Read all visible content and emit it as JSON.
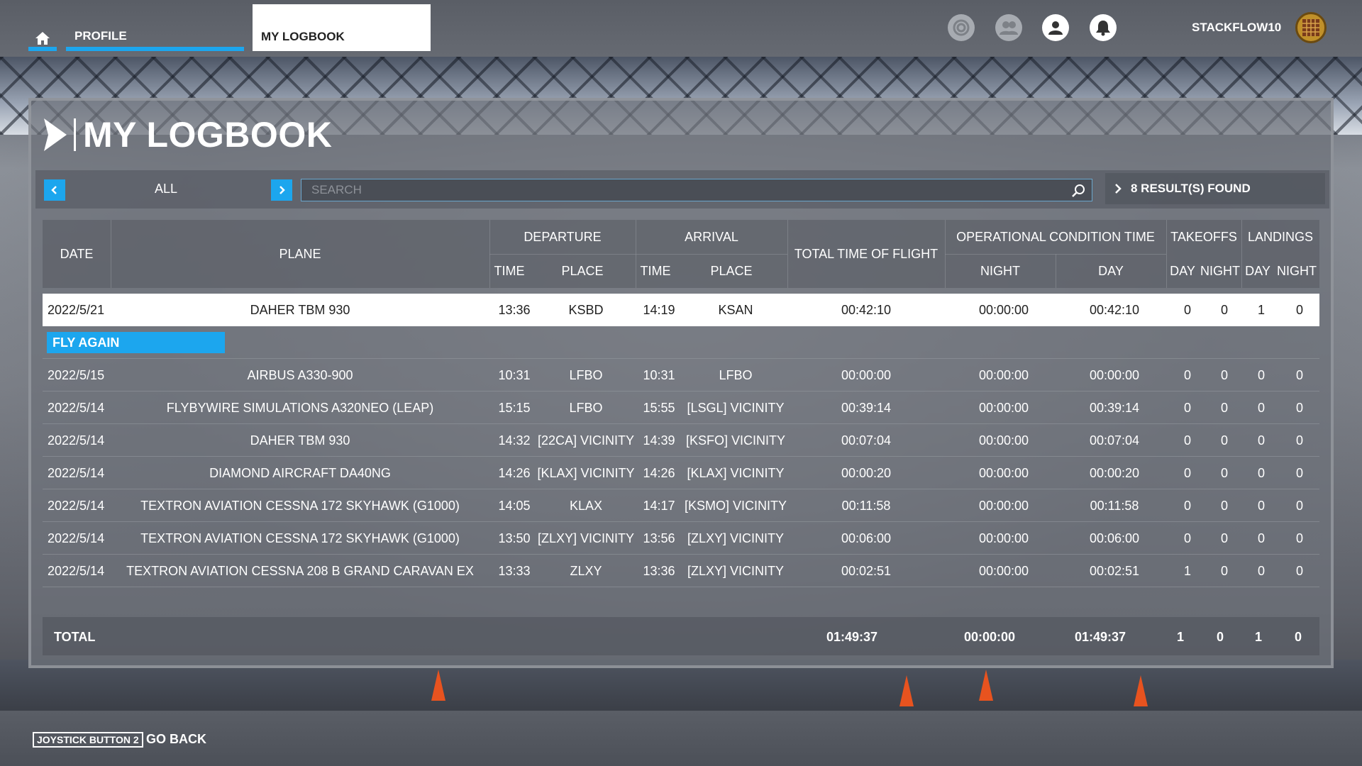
{
  "nav": {
    "profile_label": "PROFILE",
    "logbook_label": "MY LOGBOOK",
    "username": "STACKFLOW10",
    "icons": [
      "home-icon",
      "activity-icon",
      "friends-icon",
      "user-icon",
      "notification-icon"
    ]
  },
  "page": {
    "title": "MY LOGBOOK",
    "filter_label": "ALL",
    "search_placeholder": "SEARCH",
    "search_value": "",
    "results_label": "8 RESULT(S) FOUND"
  },
  "table": {
    "headers": {
      "date": "DATE",
      "plane": "PLANE",
      "departure": "DEPARTURE",
      "arrival": "ARRIVAL",
      "dep_time": "TIME",
      "dep_place": "PLACE",
      "arr_time": "TIME",
      "arr_place": "PLACE",
      "total_time": "TOTAL TIME OF FLIGHT",
      "op_cond": "OPERATIONAL CONDITION TIME",
      "night": "NIGHT",
      "day": "DAY",
      "takeoffs": "TAKEOFFS",
      "landings": "LANDINGS",
      "to_day": "DAY",
      "to_night": "NIGHT",
      "ld_day": "DAY",
      "ld_night": "NIGHT"
    },
    "fly_again_label": "FLY AGAIN",
    "rows": [
      {
        "date": "2022/5/21",
        "plane": "DAHER TBM 930",
        "dep_time": "13:36",
        "dep_place": "KSBD",
        "arr_time": "14:19",
        "arr_place": "KSAN",
        "total": "00:42:10",
        "night": "00:00:00",
        "day": "00:42:10",
        "to_day": "0",
        "to_night": "0",
        "ld_day": "1",
        "ld_night": "0"
      },
      {
        "date": "2022/5/15",
        "plane": "AIRBUS A330-900",
        "dep_time": "10:31",
        "dep_place": "LFBO",
        "arr_time": "10:31",
        "arr_place": "LFBO",
        "total": "00:00:00",
        "night": "00:00:00",
        "day": "00:00:00",
        "to_day": "0",
        "to_night": "0",
        "ld_day": "0",
        "ld_night": "0"
      },
      {
        "date": "2022/5/14",
        "plane": "FLYBYWIRE SIMULATIONS A320NEO (LEAP)",
        "dep_time": "15:15",
        "dep_place": "LFBO",
        "arr_time": "15:55",
        "arr_place": "[LSGL] VICINITY",
        "total": "00:39:14",
        "night": "00:00:00",
        "day": "00:39:14",
        "to_day": "0",
        "to_night": "0",
        "ld_day": "0",
        "ld_night": "0"
      },
      {
        "date": "2022/5/14",
        "plane": "DAHER TBM 930",
        "dep_time": "14:32",
        "dep_place": "[22CA] VICINITY",
        "arr_time": "14:39",
        "arr_place": "[KSFO] VICINITY",
        "total": "00:07:04",
        "night": "00:00:00",
        "day": "00:07:04",
        "to_day": "0",
        "to_night": "0",
        "ld_day": "0",
        "ld_night": "0"
      },
      {
        "date": "2022/5/14",
        "plane": "DIAMOND AIRCRAFT DA40NG",
        "dep_time": "14:26",
        "dep_place": "[KLAX] VICINITY",
        "arr_time": "14:26",
        "arr_place": "[KLAX] VICINITY",
        "total": "00:00:20",
        "night": "00:00:00",
        "day": "00:00:20",
        "to_day": "0",
        "to_night": "0",
        "ld_day": "0",
        "ld_night": "0"
      },
      {
        "date": "2022/5/14",
        "plane": "TEXTRON AVIATION CESSNA 172 SKYHAWK (G1000)",
        "dep_time": "14:05",
        "dep_place": "KLAX",
        "arr_time": "14:17",
        "arr_place": "[KSMO] VICINITY",
        "total": "00:11:58",
        "night": "00:00:00",
        "day": "00:11:58",
        "to_day": "0",
        "to_night": "0",
        "ld_day": "0",
        "ld_night": "0"
      },
      {
        "date": "2022/5/14",
        "plane": "TEXTRON AVIATION CESSNA 172 SKYHAWK (G1000)",
        "dep_time": "13:50",
        "dep_place": "[ZLXY] VICINITY",
        "arr_time": "13:56",
        "arr_place": "[ZLXY] VICINITY",
        "total": "00:06:00",
        "night": "00:00:00",
        "day": "00:06:00",
        "to_day": "0",
        "to_night": "0",
        "ld_day": "0",
        "ld_night": "0"
      },
      {
        "date": "2022/5/14",
        "plane": "TEXTRON AVIATION CESSNA 208 B GRAND CARAVAN EX",
        "dep_time": "13:33",
        "dep_place": "ZLXY",
        "arr_time": "13:36",
        "arr_place": "[ZLXY] VICINITY",
        "total": "00:02:51",
        "night": "00:00:00",
        "day": "00:02:51",
        "to_day": "1",
        "to_night": "0",
        "ld_day": "0",
        "ld_night": "0"
      }
    ],
    "total": {
      "label": "TOTAL",
      "total": "01:49:37",
      "night": "00:00:00",
      "day": "01:49:37",
      "to_day": "1",
      "to_night": "0",
      "ld_day": "1",
      "ld_night": "0"
    }
  },
  "footer": {
    "joystick_label": "JOYSTICK BUTTON 2",
    "go_back_label": "GO BACK"
  },
  "colors": {
    "accent": "#1ca6ee",
    "selected_row": "#ffffff"
  }
}
